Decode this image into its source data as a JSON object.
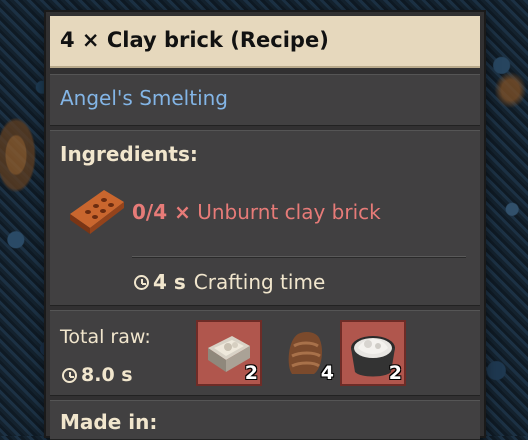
{
  "tooltip": {
    "title": "4 × Clay brick (Recipe)",
    "mod": "Angel's Smelting",
    "ingredients_heading": "Ingredients:",
    "ingredients": [
      {
        "icon": "unburnt-clay-brick-icon",
        "count": "0/4 ×",
        "name": "Unburnt clay brick"
      }
    ],
    "crafting_time_value": "4 s",
    "crafting_time_label": "Crafting time",
    "total_raw_heading": "Total raw:",
    "total_raw_time": "8.0 s",
    "raw_items": [
      {
        "icon": "cement-mixture-icon",
        "count": "2",
        "highlighted": true
      },
      {
        "icon": "clay-icon",
        "count": "4",
        "highlighted": false
      },
      {
        "icon": "powder-bucket-icon",
        "count": "2",
        "highlighted": true
      }
    ],
    "made_in_heading": "Made in:"
  },
  "colors": {
    "title_bg": "#e6d8bd",
    "panel_bg": "#414041",
    "mod_text": "#83b5e6",
    "missing_ingredient": "#e77b78",
    "heading_text": "#f1e6cd",
    "slot_highlight": "#b0564d"
  }
}
